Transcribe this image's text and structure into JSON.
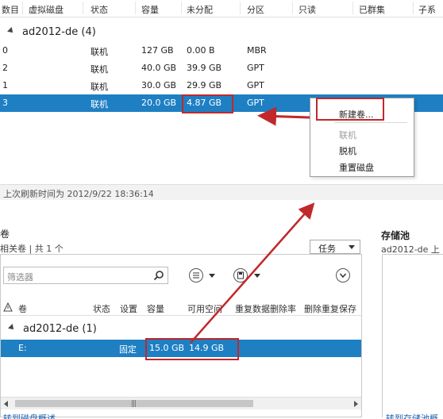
{
  "disk_table": {
    "headers": [
      "数目",
      "虚拟磁盘",
      "状态",
      "容量",
      "未分配",
      "分区",
      "只读",
      "已群集",
      "子系"
    ],
    "group": "ad2012-de (4)",
    "rows": [
      {
        "number": "0",
        "status": "联机",
        "capacity": "127 GB",
        "unallocated": "0.00 B",
        "partition": "MBR"
      },
      {
        "number": "2",
        "status": "联机",
        "capacity": "40.0 GB",
        "unallocated": "39.9 GB",
        "partition": "GPT"
      },
      {
        "number": "1",
        "status": "联机",
        "capacity": "30.0 GB",
        "unallocated": "29.9 GB",
        "partition": "GPT"
      },
      {
        "number": "3",
        "status": "联机",
        "capacity": "20.0 GB",
        "unallocated": "4.87 GB",
        "partition": "GPT",
        "selected": true
      }
    ]
  },
  "context_menu": {
    "items": [
      {
        "label": "新建卷...",
        "enabled": true
      },
      {
        "label": "联机",
        "enabled": false
      },
      {
        "label": "脱机",
        "enabled": true
      },
      {
        "label": "重置磁盘",
        "enabled": true
      }
    ]
  },
  "refresh": {
    "text": "上次刷新时间为 2012/9/22 18:36:14"
  },
  "volumes_panel": {
    "title": "卷",
    "subtitle": "相关卷 | 共 1 个",
    "task_label": "任务",
    "filter_placeholder": "筛选器",
    "headers": [
      "卷",
      "状态",
      "设置",
      "容量",
      "可用空间",
      "重复数据删除率",
      "删除重复保存"
    ],
    "group": "ad2012-de (1)",
    "row": {
      "volume": "E:",
      "setting": "固定",
      "capacity": "15.0 GB",
      "free": "14.9 GB"
    },
    "bottom_link": "转到磁盘概述"
  },
  "storage_pool": {
    "title": "存储池",
    "subtitle": "ad2012-de 上",
    "bottom_link": "转到存储池概述"
  },
  "colors": {
    "selection": "#1e7fc3",
    "annotation_red": "#c0282b"
  }
}
